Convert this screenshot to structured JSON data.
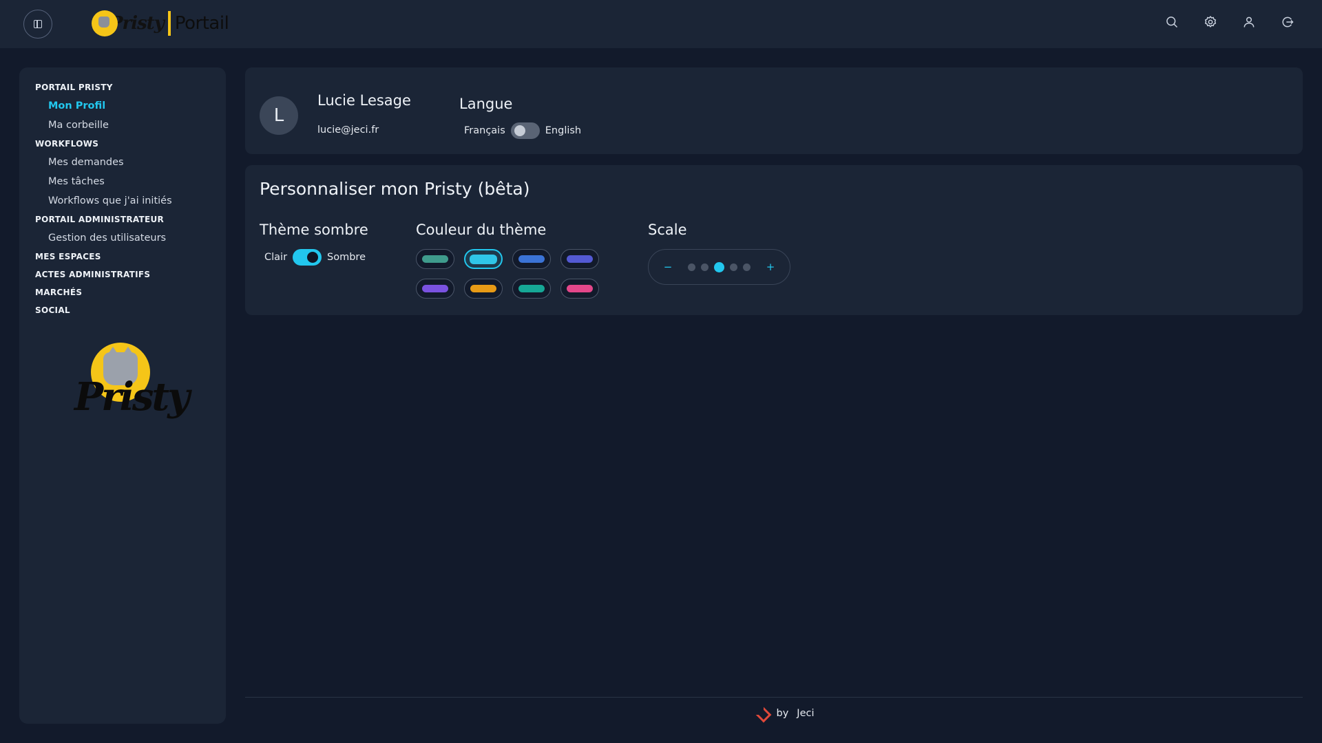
{
  "header": {
    "brand_name": "Pristy",
    "brand_suffix": "Portail",
    "icons": [
      "search-icon",
      "settings-icon",
      "user-icon",
      "logout-icon"
    ]
  },
  "sidebar": {
    "sections": [
      {
        "label": "PORTAIL PRISTY",
        "items": [
          {
            "label": "Mon Profil",
            "active": true
          },
          {
            "label": "Ma corbeille",
            "active": false
          }
        ]
      },
      {
        "label": "WORKFLOWS",
        "items": [
          {
            "label": "Mes demandes",
            "active": false
          },
          {
            "label": "Mes tâches",
            "active": false
          },
          {
            "label": "Workflows que j'ai initiés",
            "active": false
          }
        ]
      },
      {
        "label": "PORTAIL ADMINISTRATEUR",
        "items": [
          {
            "label": "Gestion des utilisateurs",
            "active": false
          }
        ]
      },
      {
        "label": "MES ESPACES",
        "items": []
      },
      {
        "label": "ACTES ADMINISTRATIFS",
        "items": []
      },
      {
        "label": "MARCHÉS",
        "items": []
      },
      {
        "label": "SOCIAL",
        "items": []
      }
    ],
    "logo_text": "Pristy"
  },
  "profile": {
    "avatar_initial": "L",
    "name": "Lucie Lesage",
    "email": "lucie@jeci.fr",
    "language": {
      "title": "Langue",
      "left_label": "Français",
      "right_label": "English",
      "english_on": false
    }
  },
  "customize": {
    "title": "Personnaliser mon Pristy (bêta)",
    "dark_theme": {
      "title": "Thème sombre",
      "left_label": "Clair",
      "right_label": "Sombre",
      "enabled": true
    },
    "theme_color": {
      "title": "Couleur du thème",
      "colors": [
        "#3f9b8c",
        "#2fc6e8",
        "#3b73d6",
        "#5359d3",
        "#7a52e0",
        "#e79a16",
        "#16a796",
        "#e3478a"
      ],
      "selected_index": 1
    },
    "scale": {
      "title": "Scale",
      "minus_label": "−",
      "plus_label": "+",
      "steps": 5,
      "selected_step": 3
    }
  },
  "footer": {
    "by_label": "by",
    "company": "Jeci"
  },
  "colors": {
    "accent": "#22c7ee",
    "background": "#121a2b",
    "card": "#1b2536"
  }
}
